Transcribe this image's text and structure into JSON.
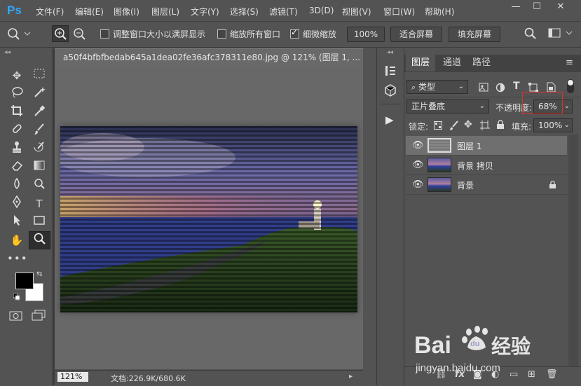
{
  "app": {
    "logo_text": "Ps"
  },
  "menu": [
    "文件(F)",
    "编辑(E)",
    "图像(I)",
    "图层(L)",
    "文字(Y)",
    "选择(S)",
    "滤镜(T)",
    "3D(D)",
    "视图(V)",
    "窗口(W)",
    "帮助(H)"
  ],
  "window_controls": {
    "minimize": "—",
    "maximize": "☐",
    "close": "✕"
  },
  "options": {
    "resize_windows_label": "调整窗口大小以满屏显示",
    "zoom_all_windows_label": "缩放所有窗口",
    "scrubby_zoom_label": "细微缩放",
    "zoom_value": "100%",
    "fit_screen_label": "适合屏幕",
    "fill_screen_label": "填充屏幕"
  },
  "document": {
    "tab_title": "a50f4bfbfbedab645a1dea02fe36afc378311e80.jpg @ 121% (图层 1, ...",
    "zoom_status": "121%",
    "doc_size": "文档:226.9K/680.6K"
  },
  "layers_panel": {
    "tabs": [
      "图层",
      "通道",
      "路径"
    ],
    "filter_label": "类型",
    "blend_mode": "正片叠底",
    "opacity_label": "不透明度:",
    "opacity_value": "68%",
    "lock_label": "锁定:",
    "fill_label": "填充:",
    "fill_value": "100%",
    "layers": [
      {
        "name": "图层 1",
        "selected": true,
        "locked": false,
        "thumb": "blank"
      },
      {
        "name": "背景 拷贝",
        "selected": false,
        "locked": false,
        "thumb": "photo"
      },
      {
        "name": "背景",
        "selected": false,
        "locked": true,
        "thumb": "photo"
      }
    ],
    "bottom_icons": [
      "link-icon",
      "fx-icon",
      "mask-icon",
      "adjustment-icon",
      "group-icon",
      "new-layer-icon",
      "trash-icon"
    ],
    "fx_label": "fx"
  },
  "watermark": {
    "brand": "Baidu经验",
    "url": "jingyan.baidu.com"
  },
  "colors": {
    "accent": "#31a8ff",
    "highlight_box": "#e0302a",
    "panel_bg": "#535353",
    "canvas_bg": "#686868"
  }
}
